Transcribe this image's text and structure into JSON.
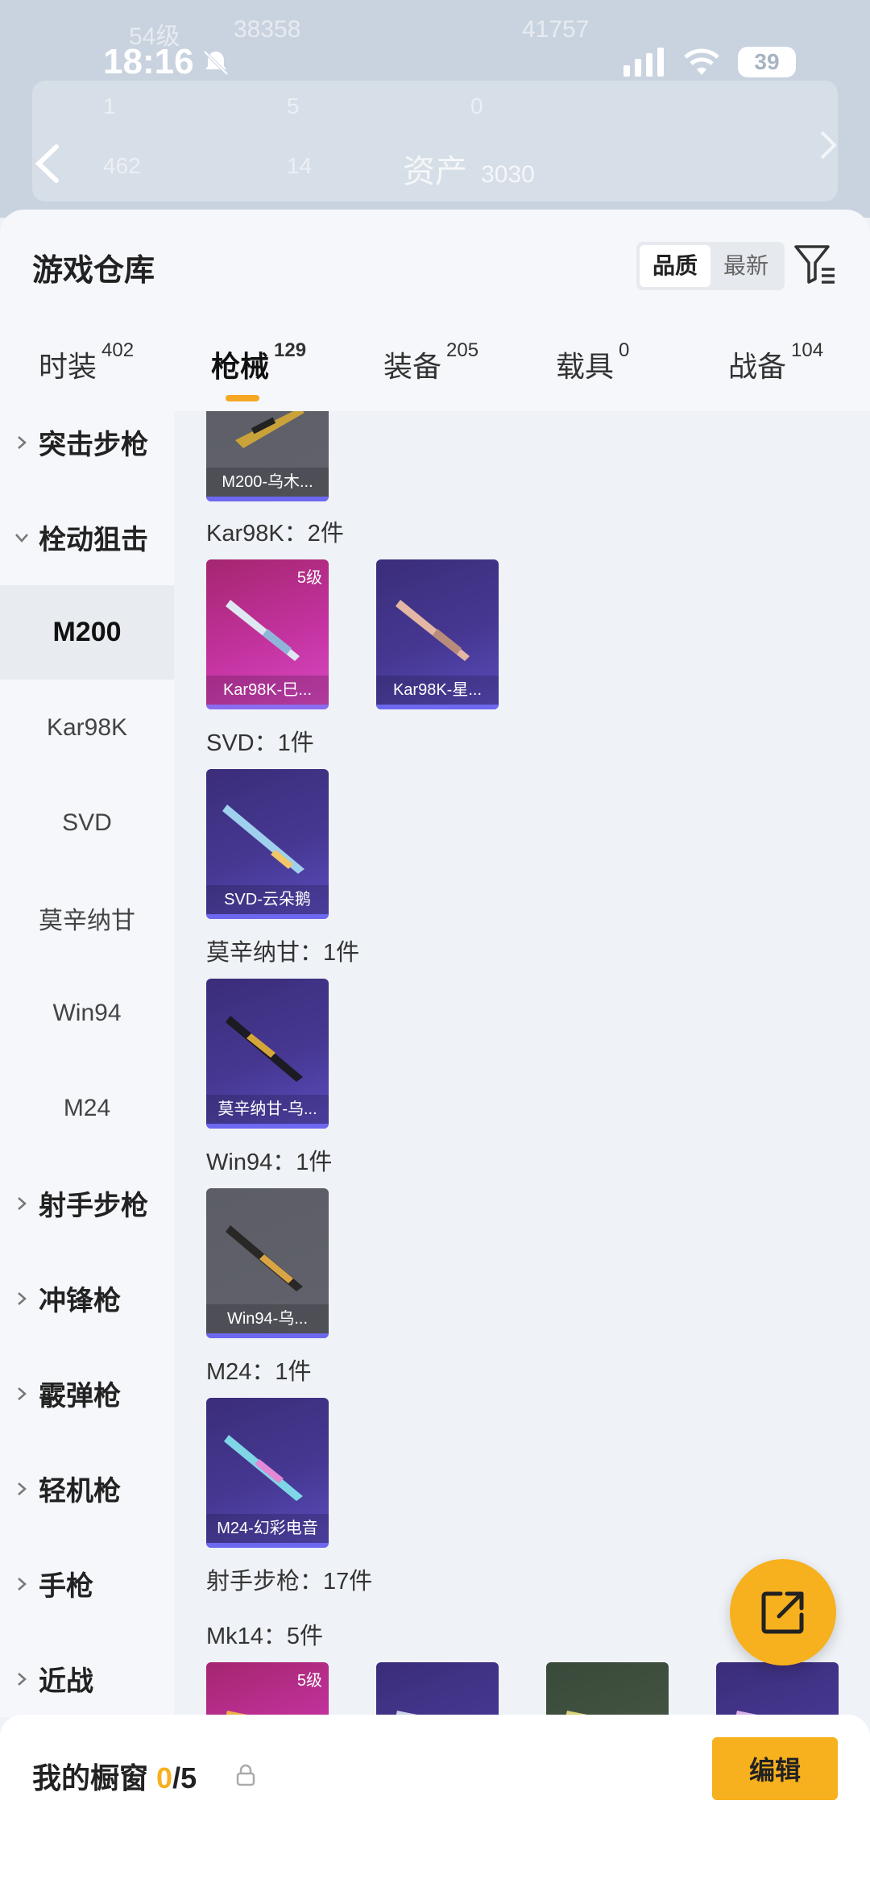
{
  "status_bar": {
    "time": "18:16",
    "battery": "39"
  },
  "background_header": {
    "level_text": "54级",
    "coins": "38358",
    "points": "41757",
    "stat_1": "1",
    "stat_2": "5",
    "stat_3": "0",
    "stat_4": "462",
    "stat_5": "14",
    "asset_label": "资产",
    "asset_value": "3030"
  },
  "sheet": {
    "title": "游戏仓库",
    "sort_options": [
      "品质",
      "最新"
    ],
    "tabs": [
      {
        "label": "时装",
        "count": "402"
      },
      {
        "label": "枪械",
        "count": "129"
      },
      {
        "label": "装备",
        "count": "205"
      },
      {
        "label": "载具",
        "count": "0"
      },
      {
        "label": "战备",
        "count": "104"
      }
    ]
  },
  "left_nav": [
    {
      "label": "突击步枪",
      "type": "category",
      "expanded": false
    },
    {
      "label": "栓动狙击",
      "type": "category",
      "expanded": true
    },
    {
      "label": "M200",
      "type": "sub",
      "active": true
    },
    {
      "label": "Kar98K",
      "type": "sub"
    },
    {
      "label": "SVD",
      "type": "sub"
    },
    {
      "label": "莫辛纳甘",
      "type": "sub"
    },
    {
      "label": "Win94",
      "type": "sub"
    },
    {
      "label": "M24",
      "type": "sub"
    },
    {
      "label": "射手步枪",
      "type": "category",
      "expanded": false
    },
    {
      "label": "冲锋枪",
      "type": "category",
      "expanded": false
    },
    {
      "label": "霰弹枪",
      "type": "category",
      "expanded": false
    },
    {
      "label": "轻机枪",
      "type": "category",
      "expanded": false
    },
    {
      "label": "手枪",
      "type": "category",
      "expanded": false
    },
    {
      "label": "近战",
      "type": "category",
      "expanded": false
    }
  ],
  "content": {
    "m200_card": {
      "name": "M200-乌木...",
      "rarity": "gray"
    },
    "groups": [
      {
        "label": "Kar98K：2件",
        "items": [
          {
            "name": "Kar98K-巳...",
            "rarity": "pink",
            "level": "5级"
          },
          {
            "name": "Kar98K-星...",
            "rarity": "purple"
          }
        ]
      },
      {
        "label": "SVD：1件",
        "items": [
          {
            "name": "SVD-云朵鹅",
            "rarity": "purple"
          }
        ]
      },
      {
        "label": "莫辛纳甘：1件",
        "items": [
          {
            "name": "莫辛纳甘-乌...",
            "rarity": "purple"
          }
        ]
      },
      {
        "label": "Win94：1件",
        "items": [
          {
            "name": "Win94-乌...",
            "rarity": "gray"
          }
        ]
      },
      {
        "label": "M24：1件",
        "items": [
          {
            "name": "M24-幻彩电音",
            "rarity": "purple"
          }
        ]
      }
    ],
    "section_label": "射手步枪：17件",
    "mk14_label": "Mk14：5件",
    "mk14_level": "5级"
  },
  "bottom": {
    "showcase_label": "我的橱窗",
    "showcase_count": "0",
    "showcase_total": "/5",
    "edit_label": "编辑"
  },
  "colors": {
    "accent": "#f7b01e",
    "purple_card": "#463892",
    "pink_card": "#c433a0",
    "gray_card": "#5e5f68"
  },
  "icons": [
    "bell-mute-icon",
    "signal-icon",
    "wifi-icon",
    "back-icon",
    "filter-icon",
    "share-icon",
    "lock-icon",
    "caret-right-icon",
    "caret-down-icon"
  ]
}
